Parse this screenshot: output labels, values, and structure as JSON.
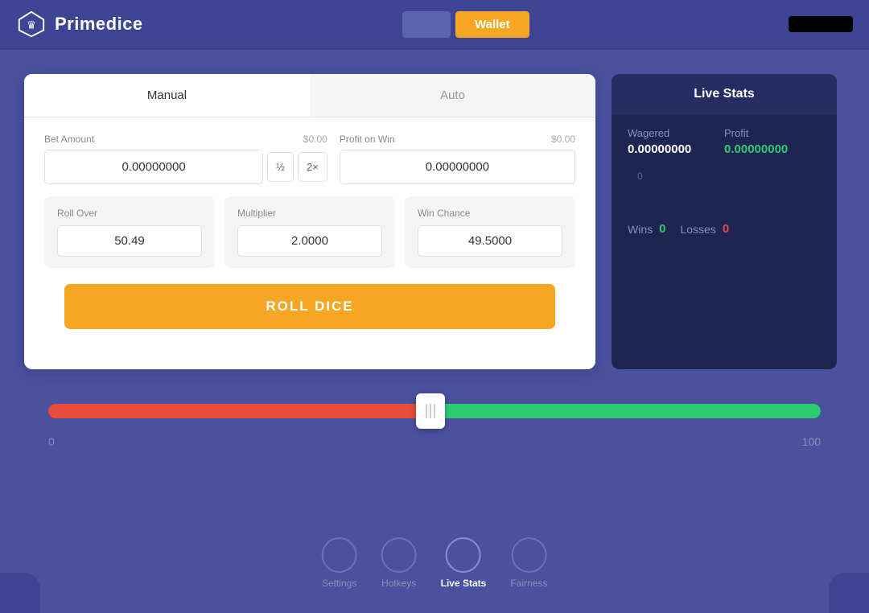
{
  "app": {
    "name": "Primedice"
  },
  "header": {
    "login_placeholder": "",
    "wallet_label": "Wallet",
    "user_area_text": ""
  },
  "tabs": {
    "manual_label": "Manual",
    "auto_label": "Auto",
    "active": "manual"
  },
  "bet_form": {
    "bet_amount_label": "Bet Amount",
    "bet_amount_value": "0.00000000",
    "bet_amount_dollar": "$0.00",
    "half_label": "½",
    "double_label": "2×",
    "profit_label": "Profit on Win",
    "profit_value": "0.00000000",
    "profit_dollar": "$0.00",
    "roll_over_label": "Roll Over",
    "roll_over_value": "50.49",
    "multiplier_label": "Multiplier",
    "multiplier_value": "2.0000",
    "win_chance_label": "Win Chance",
    "win_chance_value": "49.5000",
    "roll_btn_label": "ROLL DICE"
  },
  "live_stats": {
    "title": "Live Stats",
    "wagered_label": "Wagered",
    "wagered_value": "0.00000000",
    "profit_label": "Profit",
    "profit_value": "0.00000000",
    "chart_zero": "0",
    "wins_label": "Wins",
    "wins_value": "0",
    "losses_label": "Losses",
    "losses_value": "0"
  },
  "slider": {
    "min_label": "0",
    "max_label": "100",
    "position": 49.5
  },
  "bottom_nav": [
    {
      "id": "settings",
      "label": "Settings",
      "active": false
    },
    {
      "id": "hotkeys",
      "label": "Hotkeys",
      "active": false
    },
    {
      "id": "live-stats",
      "label": "Live Stats",
      "active": true
    },
    {
      "id": "fairness",
      "label": "Fairness",
      "active": false
    }
  ]
}
